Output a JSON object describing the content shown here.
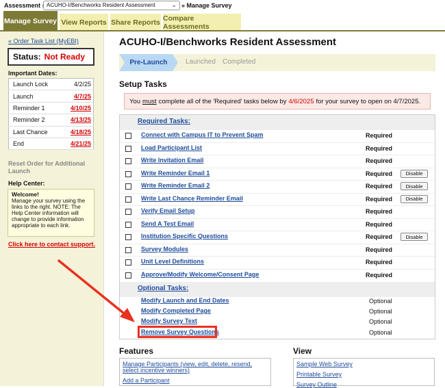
{
  "topbar": {
    "assessment_label": "Assessment »",
    "assessment_value": "ACUHO-I/Benchworks Resident Assessment",
    "after_label": "» Manage Survey"
  },
  "tabs": [
    "Manage Survey",
    "View Reports",
    "Share Reports",
    "Compare Assessments"
  ],
  "sidebar": {
    "order_link": "« Order Task List (MyEBI)",
    "status_label": "Status:",
    "status_value": "Not Ready",
    "important_dates_heading": "Important Dates:",
    "dates": [
      {
        "label": "Launch Lock",
        "date": "4/2/25"
      },
      {
        "label": "Launch",
        "date": "4/7/25"
      },
      {
        "label": "Reminder 1",
        "date": "4/10/25"
      },
      {
        "label": "Reminder 2",
        "date": "4/13/25"
      },
      {
        "label": "Last Chance",
        "date": "4/18/25"
      },
      {
        "label": "End",
        "date": "4/21/25"
      }
    ],
    "reset_text": "Reset Order for Additional Launch",
    "help_heading": "Help Center:",
    "welcome_title": "Welcome!",
    "welcome_text": "Manage your survey using the links to the right. NOTE: The Help Center information will change to provide information appropriate to each link.",
    "contact_link": "Click here to contact support."
  },
  "main": {
    "title": "ACUHO-I/Benchworks Resident Assessment",
    "steps": [
      "Pre-Launch",
      "Launched",
      "Completed"
    ],
    "setup_heading": "Setup Tasks",
    "notice": {
      "part1": "You",
      "must": "must",
      "part2": "complete all of the 'Required' tasks below by",
      "deadline": "4/6/2025",
      "part3": "for your survey to open on 4/7/2025."
    },
    "required_heading": "Required Tasks:",
    "required_tasks": [
      {
        "name": "Connect with Campus IT to Prevent Spam",
        "status": "Required",
        "action": ""
      },
      {
        "name": "Load Participant List",
        "status": "Required",
        "action": ""
      },
      {
        "name": "Write Invitation Email",
        "status": "Required",
        "action": ""
      },
      {
        "name": "Write Reminder Email 1",
        "status": "Required",
        "action": "Disable"
      },
      {
        "name": "Write Reminder Email 2",
        "status": "Required",
        "action": "Disable"
      },
      {
        "name": "Write Last Chance Reminder Email",
        "status": "Required",
        "action": "Disable"
      },
      {
        "name": "Verify Email Setup",
        "status": "Required",
        "action": ""
      },
      {
        "name": "Send A Test Email",
        "status": "Required",
        "action": ""
      },
      {
        "name": "Institution Specific Questions",
        "status": "Required",
        "action": "Disable"
      },
      {
        "name": "Survey Modules",
        "status": "Required",
        "action": ""
      },
      {
        "name": "Unit Level Definitions",
        "status": "Required",
        "action": ""
      },
      {
        "name": "Approve/Modify Welcome/Consent Page",
        "status": "Required",
        "action": ""
      }
    ],
    "optional_heading": "Optional Tasks:",
    "optional_tasks": [
      {
        "name": "Modify Launch and End Dates",
        "status": "Optional"
      },
      {
        "name": "Modify Completed Page",
        "status": "Optional"
      },
      {
        "name": "Modify Survey Text",
        "status": "Optional"
      },
      {
        "name": "Remove Survey Questions",
        "status": "Optional"
      }
    ],
    "features_heading": "Features",
    "features": [
      "Manage Participants (view, edit, delete, resend, select incentive winners)",
      "Add a Participant"
    ],
    "view_heading": "View",
    "view_items": [
      "Sample Web Survey",
      "Printable Survey",
      "Survey Outline"
    ]
  },
  "colors": {
    "tab_active": "#7d7a36",
    "tab_inactive": "#f2efb0",
    "sidebar_bg": "#f4f2d8",
    "link": "#1e4c9a",
    "alert_red": "#d40000",
    "annotation_red": "#e8311e"
  }
}
